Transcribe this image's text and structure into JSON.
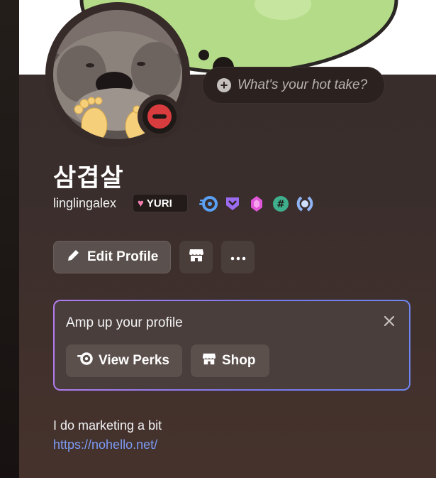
{
  "profile": {
    "display_name": "삼겹살",
    "username": "linglingalex",
    "clan_tag": "YURI",
    "status": "do-not-disturb",
    "hot_take_placeholder": "What's your hot take?",
    "badges": [
      "nitro-badge",
      "hypesquad-badge",
      "boost-gem-badge",
      "hashtag-badge",
      "quest-laurel-badge"
    ]
  },
  "actions": {
    "edit_profile_label": "Edit Profile",
    "shop_icon": "shop-icon",
    "more_icon": "more-icon"
  },
  "promo": {
    "title": "Amp up your profile",
    "view_perks_label": "View Perks",
    "shop_label": "Shop"
  },
  "bio": {
    "text": "I do marketing a bit",
    "link": "https://nohello.net/"
  },
  "colors": {
    "accent_link": "#7b9cf5",
    "status_dnd": "#d83c3e",
    "banner_green": "#b4dc88"
  }
}
